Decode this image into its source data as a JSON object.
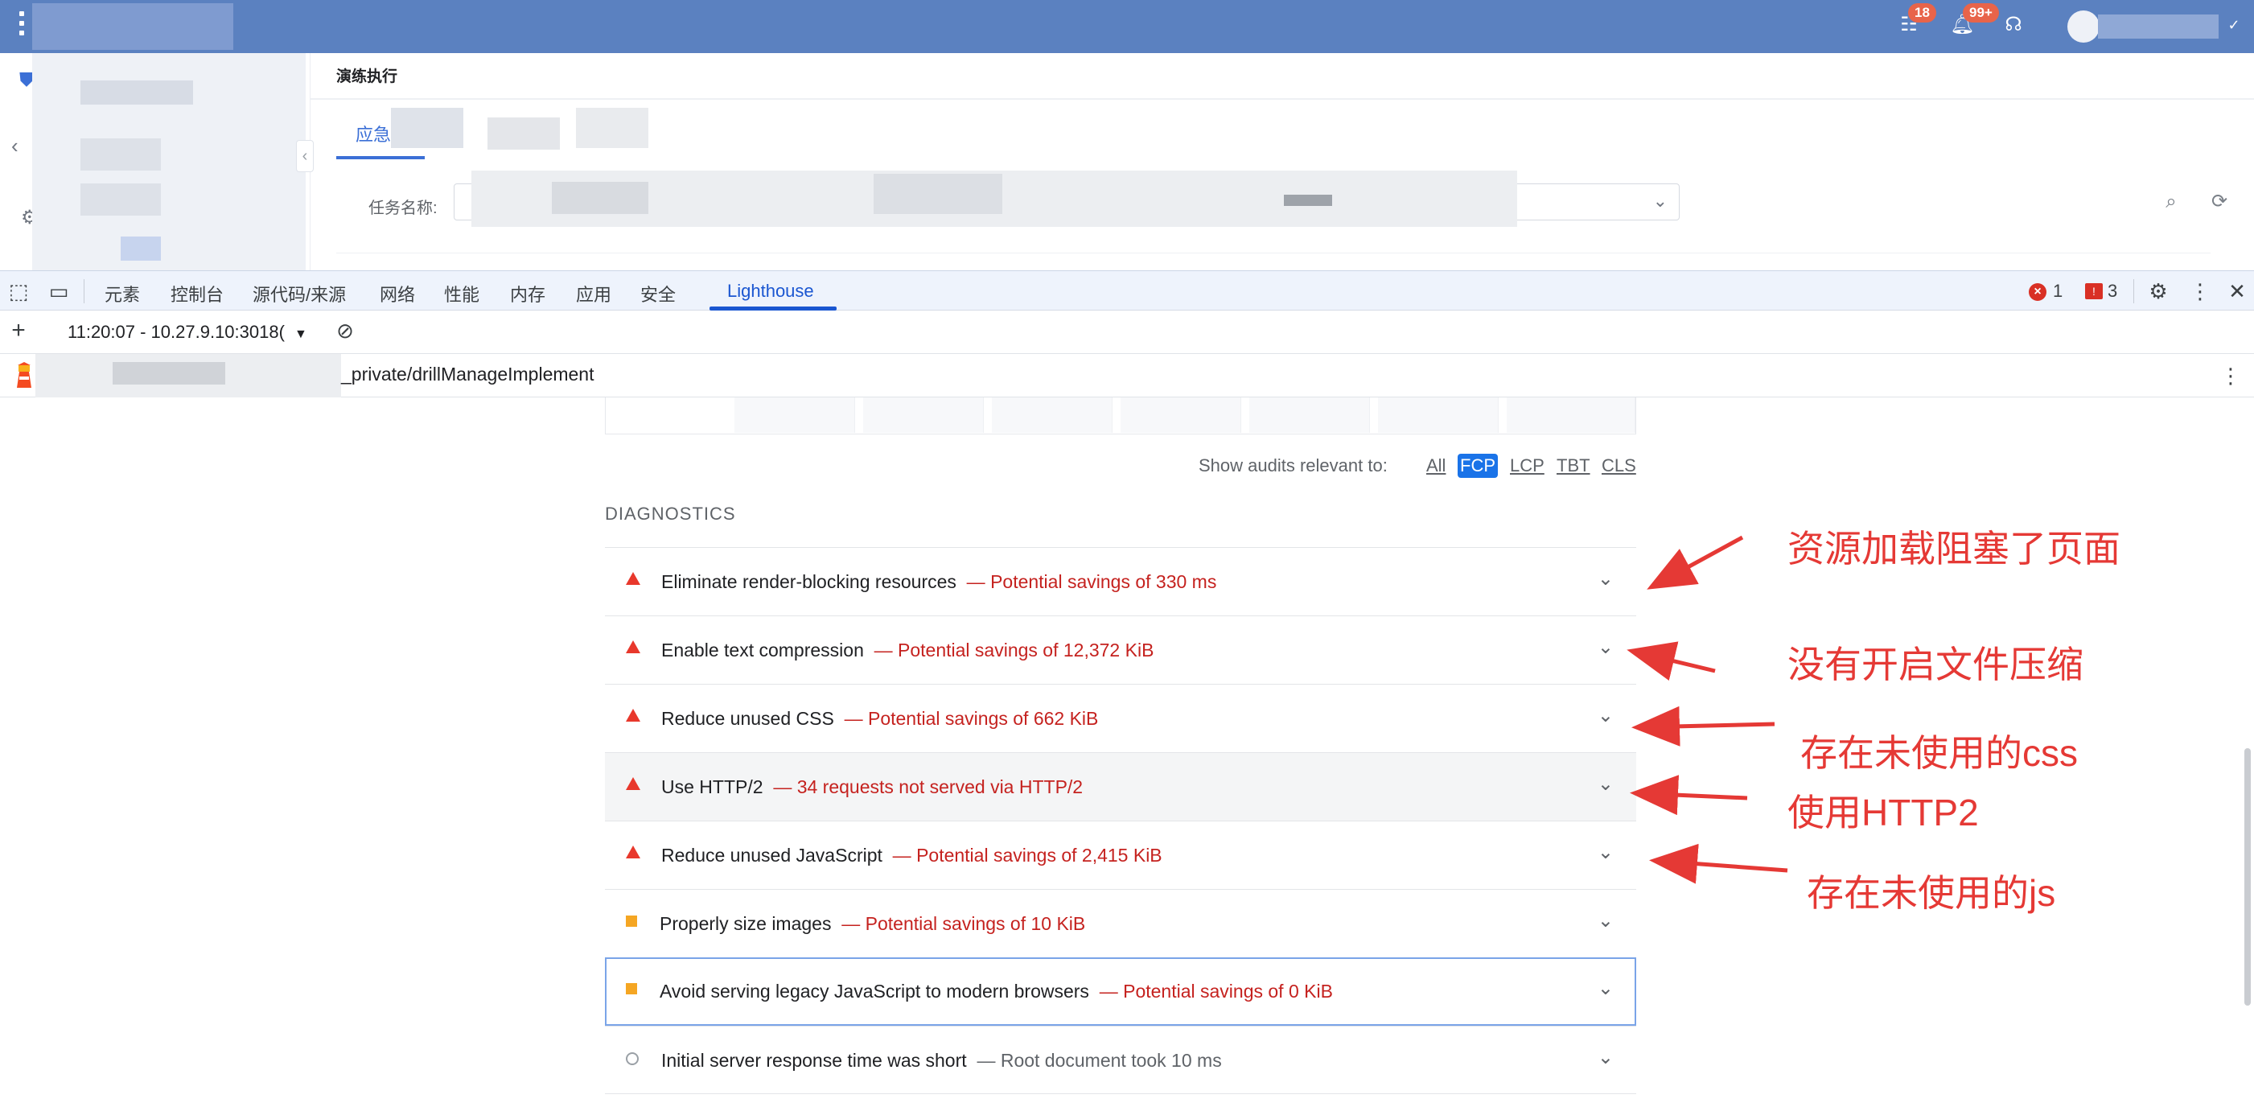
{
  "header": {
    "badges": {
      "tasks": "18",
      "notifications": "99+"
    }
  },
  "app": {
    "page_title": "演练执行",
    "tab_label": "应急",
    "filter_label": "任务名称:"
  },
  "devtools": {
    "tabs": [
      "元素",
      "控制台",
      "源代码/来源",
      "网络",
      "性能",
      "内存",
      "应用",
      "安全",
      "Lighthouse"
    ],
    "active_tab": "Lighthouse",
    "error_count": "1",
    "issue_count": "3",
    "report_select": "11:20:07 - 10.27.9.10:3018(",
    "url": "_private/drillManageImplement"
  },
  "report": {
    "filter_label": "Show audits relevant to:",
    "metrics": [
      "All",
      "FCP",
      "LCP",
      "TBT",
      "CLS"
    ],
    "active_metric": "FCP",
    "section_title": "DIAGNOSTICS",
    "separator": "—",
    "audits": [
      {
        "title": "Eliminate render-blocking resources",
        "detail": "Potential savings of 330 ms",
        "status": "fail"
      },
      {
        "title": "Enable text compression",
        "detail": "Potential savings of 12,372 KiB",
        "status": "fail"
      },
      {
        "title": "Reduce unused CSS",
        "detail": "Potential savings of 662 KiB",
        "status": "fail"
      },
      {
        "title": "Use HTTP/2",
        "detail": "34 requests not served via HTTP/2",
        "status": "fail"
      },
      {
        "title": "Reduce unused JavaScript",
        "detail": "Potential savings of 2,415 KiB",
        "status": "fail"
      },
      {
        "title": "Properly size images",
        "detail": "Potential savings of 10 KiB",
        "status": "average"
      },
      {
        "title": "Avoid serving legacy JavaScript to modern browsers",
        "detail": "Potential savings of 0 KiB",
        "status": "average"
      },
      {
        "title": "Initial server response time was short",
        "detail": "Root document took 10 ms",
        "status": "pass"
      }
    ]
  },
  "annotations": [
    "资源加载阻塞了页面",
    "没有开启文件压缩",
    "存在未使用的css",
    "使用HTTP2",
    "存在未使用的js"
  ],
  "colors": {
    "header_bg": "#5b81c0",
    "devtools_accent": "#1a56d1",
    "fail": "#e8382c",
    "average": "#f5a623",
    "annotation": "#e53935"
  }
}
